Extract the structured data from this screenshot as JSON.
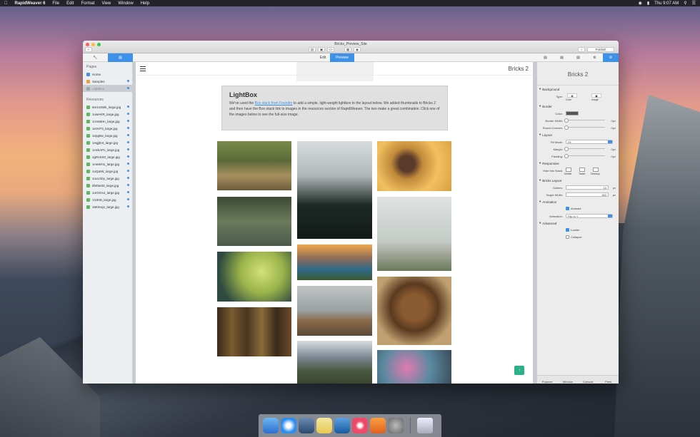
{
  "menubar": {
    "app": "RapidWeaver 6",
    "items": [
      "File",
      "Edit",
      "Format",
      "View",
      "Window",
      "Help"
    ],
    "clock": "Thu 9:07 AM"
  },
  "window": {
    "title": "Bricks_Preview_Site",
    "publish": "Publish",
    "tab_edit": "Edit",
    "tab_preview": "Preview"
  },
  "sidebar": {
    "pages_header": "Pages",
    "pages": [
      "Home",
      "Samples",
      "Lightbox"
    ],
    "resources_header": "Resources",
    "resources": [
      "6m1vSWk_large.jpg",
      "1owHKR_large.jpg",
      "1cHa5Hn_large.jpg",
      "1ecKP3_large.jpg",
      "1epg5w_large.jpg",
      "1eqjjEnt_large.jpg",
      "1HvkAFn_large.jpg",
      "1gRvSS0_large.jpg",
      "1HuWH1_large.jpg",
      "1oQaIW_large.jpg",
      "1ouU1by_large.jpg",
      "8bIt5e00_large.jpg",
      "14rOGs4_large.jpg",
      "1IUK8t_large.jpg",
      "16K9oqn_large.jpg"
    ]
  },
  "site": {
    "title": "Bricks 2"
  },
  "lightbox": {
    "heading": "LightBox",
    "p1": "We've used the ",
    "link": "Box stack from Foundry",
    "p2": " to add a simple, light-weight lightbox to the layout below. We added thumbnails to Bricks 2 and then have the Box stack link to images in the resources section of RapidWeaver. The two make a great combination. Click one of the images below to see the full-size image."
  },
  "inspector": {
    "title": "Bricks 2",
    "background": "Background",
    "type": "Type:",
    "color": "Color",
    "image": "Image",
    "border": "Border",
    "border_color": "Color:",
    "border_width": "Border Width:",
    "border_width_val": "0px",
    "round_corners": "Round Corners:",
    "round_val": "0px",
    "layout": "Layout",
    "fill_mode": "Fill Mode:",
    "fill_val": "Fit",
    "margin": "Margin:",
    "margin_val": "0px",
    "padding": "Padding:",
    "padding_val": "0px",
    "responsive": "Responsive",
    "hide_stack": "Hide this Stack:",
    "mobile": "Mobile",
    "tablet": "Tablet",
    "desktop": "Desktop",
    "bricks_layout": "Bricks Layout",
    "gutters": "Gutters:",
    "gutters_val": "10",
    "gutters_unit": "px",
    "target_width": "Target Width:",
    "target_val": "300",
    "target_unit": "px",
    "animation": "Animation",
    "animate": "Animate",
    "animation_lbl": "Animation:",
    "animation_val": "Flip In Y",
    "advanced": "Advanced",
    "loader": "Loader",
    "collapse": "Collapse",
    "bottom": [
      "Popover",
      "Window",
      "Console",
      "Prefs"
    ]
  },
  "colors": {
    "accent": "#3d91e8",
    "fab": "#2bb08a"
  }
}
